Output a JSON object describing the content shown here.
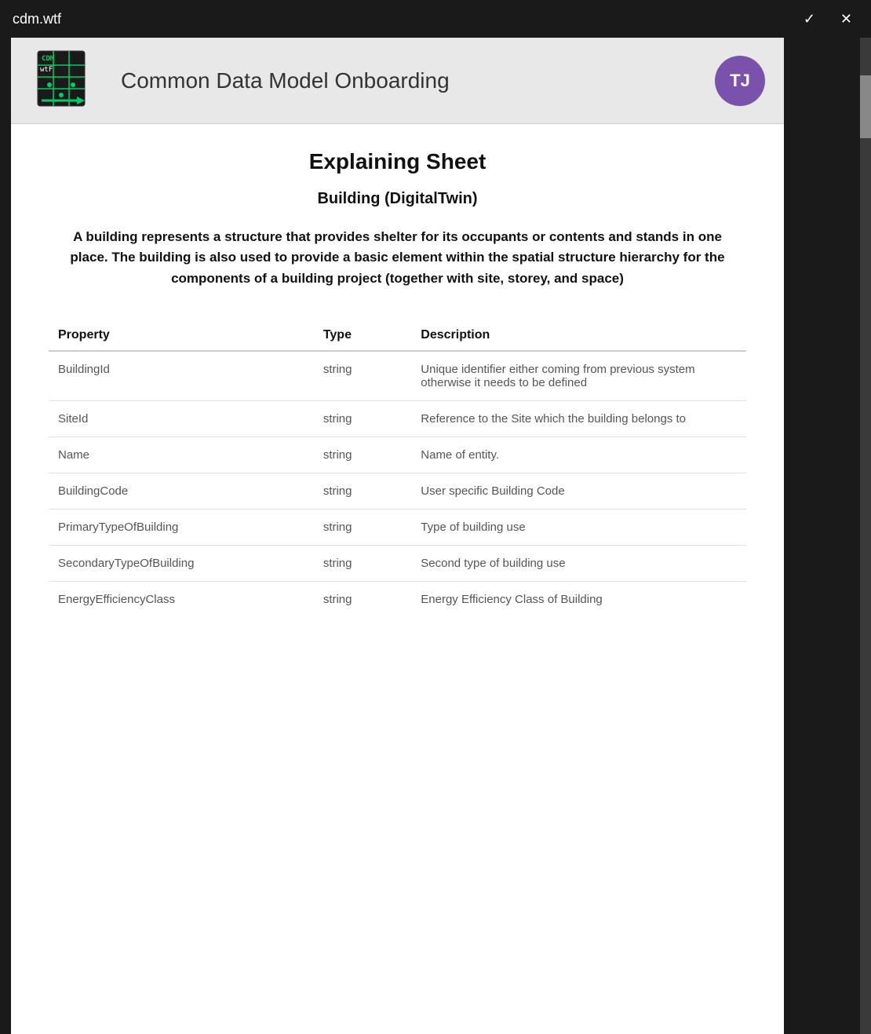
{
  "window": {
    "title": "cdm.wtf",
    "minimize_label": "✓",
    "close_label": "✕"
  },
  "header": {
    "app_title": "Common Data Model Onboarding",
    "avatar_initials": "TJ",
    "avatar_color": "#7b52ab"
  },
  "page": {
    "sheet_title": "Explaining Sheet",
    "entity_title": "Building (DigitalTwin)",
    "entity_description": "A building represents a structure that provides shelter for its occupants or contents and stands in one place. The building is also used to provide a basic element within the spatial structure hierarchy for the components of a building project (together with site, storey, and space)"
  },
  "table": {
    "columns": [
      "Property",
      "Type",
      "Description"
    ],
    "rows": [
      {
        "property": "BuildingId",
        "type": "string",
        "description": "Unique identifier either coming from previous system otherwise it needs to be defined"
      },
      {
        "property": "SiteId",
        "type": "string",
        "description": "Reference to the Site which the building belongs to"
      },
      {
        "property": "Name",
        "type": "string",
        "description": "Name of entity."
      },
      {
        "property": "BuildingCode",
        "type": "string",
        "description": "User specific Building Code"
      },
      {
        "property": "PrimaryTypeOfBuilding",
        "type": "string",
        "description": "Type of building use"
      },
      {
        "property": "SecondaryTypeOfBuilding",
        "type": "string",
        "description": "Second type of building use"
      },
      {
        "property": "EnergyEfficiencyClass",
        "type": "string",
        "description": "Energy Efficiency Class of Building"
      }
    ]
  }
}
